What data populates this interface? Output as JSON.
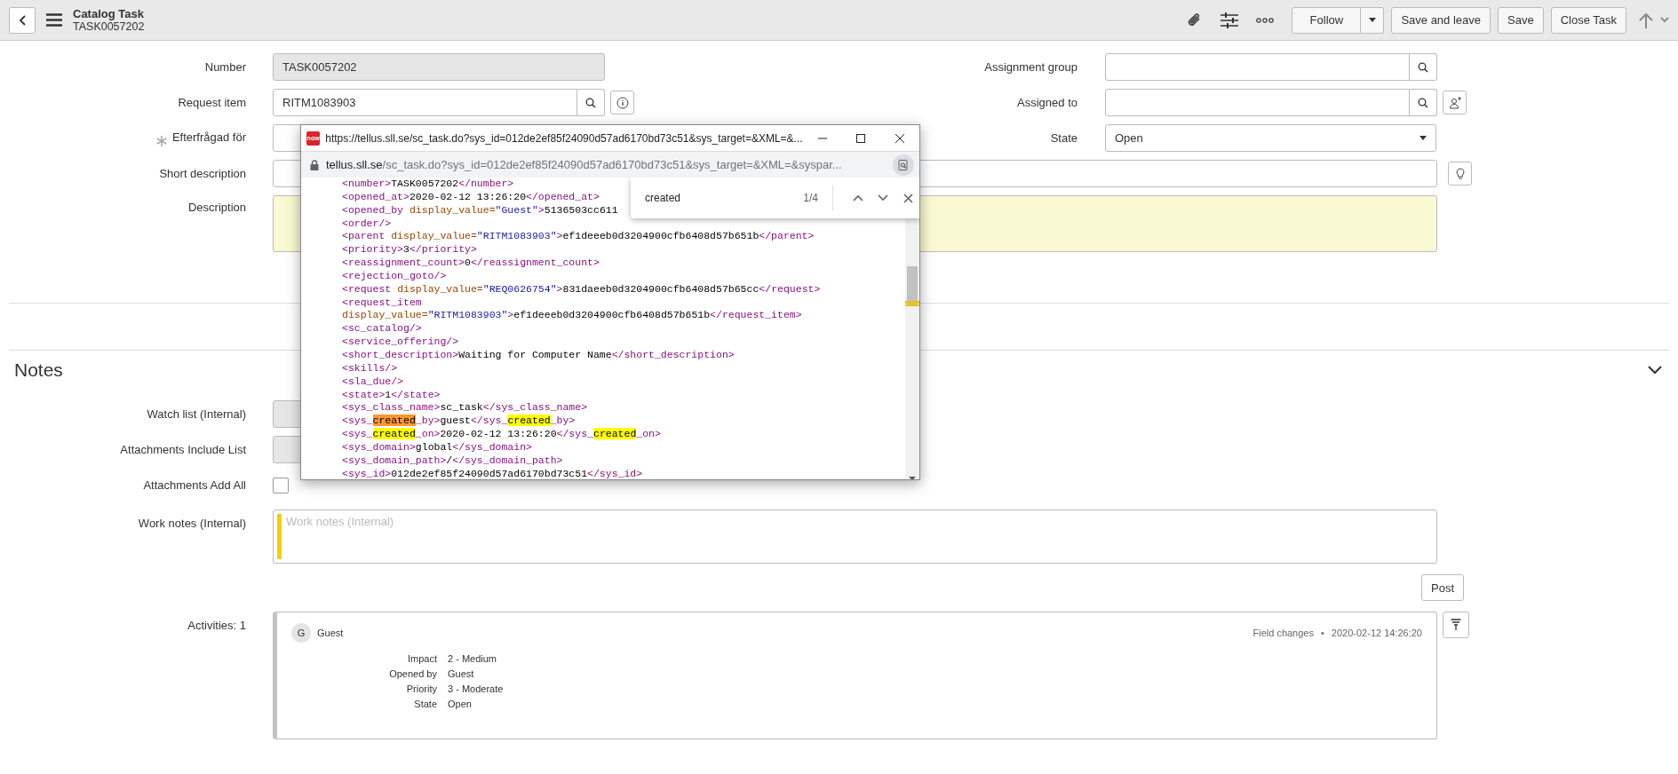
{
  "header": {
    "title": "Catalog Task",
    "subtitle": "TASK0057202",
    "follow": "Follow",
    "buttons": [
      "Save and leave",
      "Save",
      "Close Task"
    ]
  },
  "fields": [
    {
      "kind": "readonly",
      "label": "Number",
      "value": "TASK0057202"
    },
    {
      "kind": "reference_info",
      "label": "Request item",
      "value": "RITM1083903"
    },
    {
      "kind": "reference",
      "label": "Efterfrågad för",
      "required": true
    }
  ],
  "right_fields": [
    {
      "kind": "reference",
      "label": "Assignment group"
    },
    {
      "kind": "reference_assign",
      "label": "Assigned to"
    },
    {
      "kind": "select",
      "label": "State",
      "value": "Open"
    }
  ],
  "wide_fields": [
    {
      "kind": "text_hint",
      "label": "Short description"
    },
    {
      "kind": "textarea",
      "label": "Description"
    }
  ],
  "notes": {
    "title": "Notes",
    "expanded": true,
    "fields": [
      {
        "kind": "list",
        "label": "Watch list (Internal)"
      },
      {
        "kind": "list",
        "label": "Attachments Include List"
      },
      {
        "kind": "checkbox",
        "label": "Attachments Add All",
        "checked": false
      }
    ],
    "work_notes": {
      "label": "Work notes (Internal)",
      "placeholder": "Work notes (Internal)"
    },
    "post": "Post",
    "activities_label": "Activities: 1",
    "activity": {
      "initial": "G",
      "author": "Guest",
      "type": "Field changes",
      "separator": "•",
      "time": "2020-02-12 14:26:20",
      "changes": [
        {
          "label": "Impact",
          "value": "2 - Medium"
        },
        {
          "label": "Opened by",
          "value": "Guest"
        },
        {
          "label": "Priority",
          "value": "3 - Moderate"
        },
        {
          "label": "State",
          "value": "Open"
        }
      ]
    }
  },
  "popup": {
    "favicon": "now",
    "title": "https://tellus.sll.se/sc_task.do?sys_id=012de2ef85f24090d57ad6170bd73c51&sys_target=&XML=&...",
    "domain": "tellus.sll.se",
    "path": "/sc_task.do?sys_id=012de2ef85f24090d57ad6170bd73c51&sys_target=&XML=&syspar...",
    "find": {
      "query": "created",
      "count": "1/4"
    },
    "lines": [
      [
        {
          "kind": "t",
          "text": "<number>"
        },
        {
          "kind": "x",
          "text": "TASK0057202"
        },
        {
          "kind": "t",
          "text": "</number>"
        }
      ],
      [
        {
          "kind": "t",
          "text": "<opened_at>"
        },
        {
          "kind": "x",
          "text": "2020-02-12 13:26:20"
        },
        {
          "kind": "t",
          "text": "</opened_at>"
        }
      ],
      [
        {
          "kind": "t",
          "text": "<opened_by "
        },
        {
          "kind": "a",
          "text": "display_value="
        },
        {
          "kind": "v",
          "text": "\"Guest\""
        },
        {
          "kind": "t",
          "text": ">"
        },
        {
          "kind": "x",
          "text": "5136503cc611"
        }
      ],
      [
        {
          "kind": "t",
          "text": "<order/>"
        }
      ],
      [
        {
          "kind": "t",
          "text": "<parent "
        },
        {
          "kind": "a",
          "text": "display_value="
        },
        {
          "kind": "v",
          "text": "\"RITM1083903\""
        },
        {
          "kind": "t",
          "text": ">"
        },
        {
          "kind": "x",
          "text": "ef1deeeb0d3204900cfb6408d57b651b"
        },
        {
          "kind": "t",
          "text": "</parent>"
        }
      ],
      [
        {
          "kind": "t",
          "text": "<priority>"
        },
        {
          "kind": "x",
          "text": "3"
        },
        {
          "kind": "t",
          "text": "</priority>"
        }
      ],
      [
        {
          "kind": "t",
          "text": "<reassignment_count>"
        },
        {
          "kind": "x",
          "text": "0"
        },
        {
          "kind": "t",
          "text": "</reassignment_count>"
        }
      ],
      [
        {
          "kind": "t",
          "text": "<rejection_goto/>"
        }
      ],
      [
        {
          "kind": "t",
          "text": "<request "
        },
        {
          "kind": "a",
          "text": "display_value="
        },
        {
          "kind": "v",
          "text": "\"REQ0626754\""
        },
        {
          "kind": "t",
          "text": ">"
        },
        {
          "kind": "x",
          "text": "831daeeb0d3204900cfb6408d57b65cc"
        },
        {
          "kind": "t",
          "text": "</request>"
        }
      ],
      [
        {
          "kind": "t",
          "text": "<request_item"
        }
      ],
      [
        {
          "kind": "a",
          "text": "display_value="
        },
        {
          "kind": "v",
          "text": "\"RITM1083903\""
        },
        {
          "kind": "t",
          "text": ">"
        },
        {
          "kind": "x",
          "text": "ef1deeeb0d3204900cfb6408d57b651b"
        },
        {
          "kind": "t",
          "text": "</request_item>"
        }
      ],
      [
        {
          "kind": "t",
          "text": "<sc_catalog/>"
        }
      ],
      [
        {
          "kind": "t",
          "text": "<service_offering/>"
        }
      ],
      [
        {
          "kind": "t",
          "text": "<short_description>"
        },
        {
          "kind": "x",
          "text": "Waiting for Computer Name"
        },
        {
          "kind": "t",
          "text": "</short_description>"
        }
      ],
      [
        {
          "kind": "t",
          "text": "<skills/>"
        }
      ],
      [
        {
          "kind": "t",
          "text": "<sla_due/>"
        }
      ],
      [
        {
          "kind": "t",
          "text": "<state>"
        },
        {
          "kind": "x",
          "text": "1"
        },
        {
          "kind": "t",
          "text": "</state>"
        }
      ],
      [
        {
          "kind": "t",
          "text": "<sys_class_name>"
        },
        {
          "kind": "x",
          "text": "sc_task"
        },
        {
          "kind": "t",
          "text": "</sys_class_name>"
        }
      ],
      [
        {
          "kind": "t",
          "text": "<sys_"
        },
        {
          "kind": "c",
          "text": "created"
        },
        {
          "kind": "t",
          "text": "_by>"
        },
        {
          "kind": "x",
          "text": "guest"
        },
        {
          "kind": "t",
          "text": "</sys_"
        },
        {
          "kind": "m",
          "text": "created"
        },
        {
          "kind": "t",
          "text": "_by>"
        }
      ],
      [
        {
          "kind": "t",
          "text": "<sys_"
        },
        {
          "kind": "m",
          "text": "created"
        },
        {
          "kind": "t",
          "text": "_on>"
        },
        {
          "kind": "x",
          "text": "2020-02-12 13:26:20"
        },
        {
          "kind": "t",
          "text": "</sys_"
        },
        {
          "kind": "m",
          "text": "created"
        },
        {
          "kind": "t",
          "text": "_on>"
        }
      ],
      [
        {
          "kind": "t",
          "text": "<sys_domain>"
        },
        {
          "kind": "x",
          "text": "global"
        },
        {
          "kind": "t",
          "text": "</sys_domain>"
        }
      ],
      [
        {
          "kind": "t",
          "text": "<sys_domain_path>"
        },
        {
          "kind": "x",
          "text": "/"
        },
        {
          "kind": "t",
          "text": "</sys_domain_path>"
        }
      ],
      [
        {
          "kind": "t",
          "text": "<sys_id>"
        },
        {
          "kind": "x",
          "text": "012de2ef85f24090d57ad6170bd73c51"
        },
        {
          "kind": "t",
          "text": "</sys_id>"
        }
      ]
    ]
  }
}
